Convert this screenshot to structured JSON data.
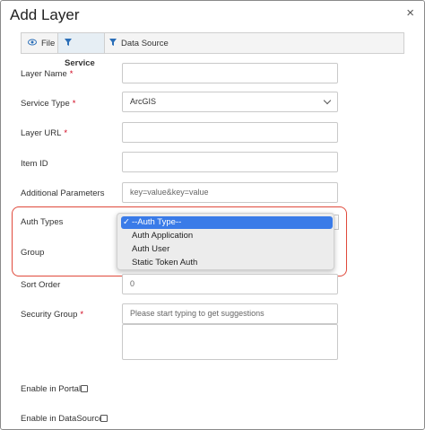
{
  "modal": {
    "title": "Add Layer",
    "close_label": "×"
  },
  "tabs": [
    {
      "label": "File",
      "icon": "eye-icon",
      "active": false
    },
    {
      "label": "Service",
      "icon": "filter-icon",
      "active": true
    },
    {
      "label": "Data Source",
      "icon": "filter-icon",
      "active": false
    }
  ],
  "form": {
    "layer_name": {
      "label": "Layer Name",
      "required": "*",
      "value": ""
    },
    "service_type": {
      "label": "Service Type",
      "required": "*",
      "value": "ArcGIS"
    },
    "layer_url": {
      "label": "Layer URL",
      "required": "*",
      "value": ""
    },
    "item_id": {
      "label": "Item ID",
      "value": ""
    },
    "additional_parameters": {
      "label": "Additional Parameters",
      "placeholder": "key=value&key=value"
    },
    "auth_types": {
      "label": "Auth Types",
      "options": [
        "--Auth Type--",
        "Auth Application",
        "Auth User",
        "Static Token Auth"
      ],
      "selected": "--Auth Type--",
      "check": "✓"
    },
    "group": {
      "label": "Group"
    },
    "sort_order": {
      "label": "Sort Order",
      "placeholder": "0"
    },
    "security_group": {
      "label": "Security Group",
      "required": "*",
      "placeholder": "Please start typing to get suggestions"
    },
    "enable_in_portal": {
      "label": "Enable in Portal",
      "checked": false
    },
    "enable_in_datasource": {
      "label": "Enable in DataSource",
      "checked": false
    }
  },
  "colors": {
    "accent": "#3a7be8",
    "highlight_border": "#e0493b",
    "required": "#d0021b"
  }
}
